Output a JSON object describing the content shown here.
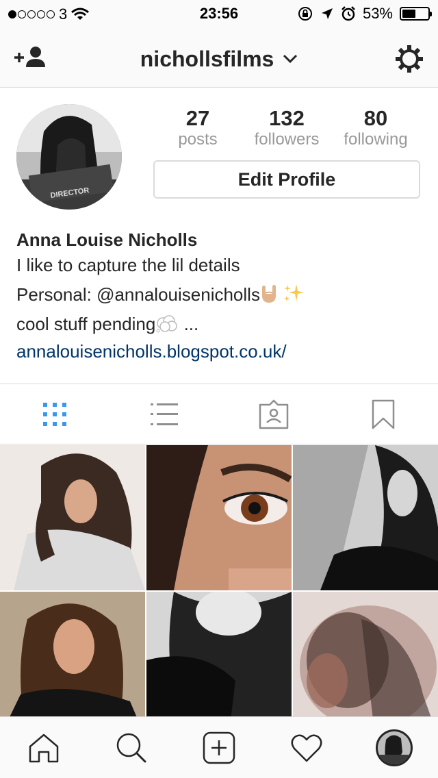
{
  "status_bar": {
    "carrier": "3",
    "time": "23:56",
    "battery": "53%",
    "battery_level": 0.53,
    "signal_bars_filled": 1,
    "signal_bars_total": 5,
    "icons": [
      "wifi-icon",
      "orientation-lock-icon",
      "location-arrow-icon",
      "alarm-icon",
      "battery-icon"
    ]
  },
  "nav": {
    "username": "nichollsfilms",
    "chevron": "⌄",
    "left_icon": "add-person-icon",
    "right_icon": "settings-gear-icon"
  },
  "profile": {
    "avatar_text": "DIRECTOR",
    "stats": [
      {
        "value": "27",
        "label": "posts"
      },
      {
        "value": "132",
        "label": "followers"
      },
      {
        "value": "80",
        "label": "following"
      }
    ],
    "edit_button": "Edit Profile",
    "name": "Anna Louise Nicholls",
    "bio_line1": "I like to capture the lil details",
    "bio_line2": "Personal: @annalouisenicholls",
    "bio_line3": "cool stuff pending",
    "bio_line3_suffix": " ...",
    "website": "annalouisenicholls.blogspot.co.uk/"
  },
  "view_tabs": [
    {
      "icon": "grid-view-icon",
      "active": true
    },
    {
      "icon": "list-view-icon",
      "active": false
    },
    {
      "icon": "tagged-photos-icon",
      "active": false
    },
    {
      "icon": "saved-bookmark-icon",
      "active": false
    }
  ],
  "colors": {
    "active_tab": "#3897f0",
    "link": "#003569",
    "muted": "#999999",
    "border": "#dbdbdb"
  },
  "bottom_tabs": [
    "home-icon",
    "search-icon",
    "new-post-icon",
    "activity-heart-icon",
    "profile-avatar"
  ]
}
